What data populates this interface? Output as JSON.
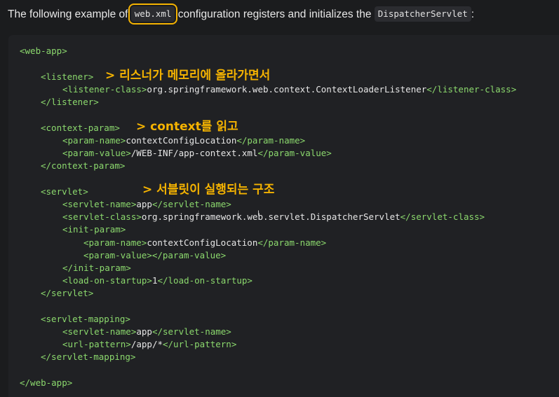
{
  "intro": {
    "before": "The following example of ",
    "code1": "web.xml",
    "middle": " configuration registers and initializes the ",
    "code2": "DispatcherServlet",
    "after": ":"
  },
  "annotations": {
    "listener_note": "> 리스너가 메모리에 올라가면서",
    "context_note": "> context를 읽고",
    "servlet_note": "> 서블릿이 실행되는 구조"
  },
  "code": {
    "web_app_open": "<web-app>",
    "listener_open": "<listener>",
    "listener_class_open": "<listener-class>",
    "listener_class_value": "org.springframework.web.context.ContextLoaderListener",
    "listener_class_close": "</listener-class>",
    "listener_close": "</listener>",
    "context_param_open": "<context-param>",
    "param_name_open": "<param-name>",
    "param_name_value": "contextConfigLocation",
    "param_name_close": "</param-name>",
    "param_value_open": "<param-value>",
    "param_value_value": "/WEB-INF/app-context.xml",
    "param_value_close": "</param-value>",
    "context_param_close": "</context-param>",
    "servlet_open": "<servlet>",
    "servlet_name_open": "<servlet-name>",
    "servlet_name_value": "app",
    "servlet_name_close": "</servlet-name>",
    "servlet_class_open": "<servlet-class>",
    "servlet_class_value": "org.springframework.web.servlet.DispatcherServlet",
    "servlet_class_close": "</servlet-class>",
    "init_param_open": "<init-param>",
    "init_param_name_open": "<param-name>",
    "init_param_name_value": "contextConfigLocation",
    "init_param_name_close": "</param-name>",
    "init_param_value_tags": "<param-value></param-value>",
    "init_param_close": "</init-param>",
    "load_on_startup_open": "<load-on-startup>",
    "load_on_startup_value": "1",
    "load_on_startup_close": "</load-on-startup>",
    "servlet_close": "</servlet>",
    "servlet_mapping_open": "<servlet-mapping>",
    "mapping_servlet_name_open": "<servlet-name>",
    "mapping_servlet_name_value": "app",
    "mapping_servlet_name_close": "</servlet-name>",
    "url_pattern_open": "<url-pattern>",
    "url_pattern_value": "/app/*",
    "url_pattern_close": "</url-pattern>",
    "servlet_mapping_close": "</servlet-mapping>",
    "web_app_close": "</web-app>"
  },
  "colors": {
    "tag": "#8bd86d",
    "highlight": "#f5b301",
    "code_background": "#202124"
  }
}
